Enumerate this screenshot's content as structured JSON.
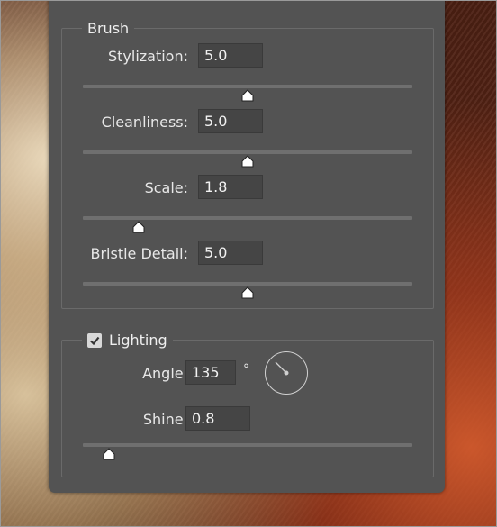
{
  "brush": {
    "title": "Brush",
    "controls": [
      {
        "label": "Stylization:",
        "value": "5.0",
        "slider_fraction": 0.5
      },
      {
        "label": "Cleanliness:",
        "value": "5.0",
        "slider_fraction": 0.5
      },
      {
        "label": "Scale:",
        "value": "1.8",
        "slider_fraction": 0.17
      },
      {
        "label": "Bristle Detail:",
        "value": "5.0",
        "slider_fraction": 0.5
      }
    ]
  },
  "lighting": {
    "title": "Lighting",
    "checked": true,
    "angle_label": "Angle:",
    "angle_value": "135",
    "angle_unit": "°",
    "angle_degrees": 135,
    "shine_label": "Shine:",
    "shine_value": "0.8",
    "shine_slider_fraction": 0.08
  },
  "colors": {
    "panel": "#535353",
    "field": "#454545",
    "track": "#6f6f6f",
    "thumb": "#ffffff"
  }
}
